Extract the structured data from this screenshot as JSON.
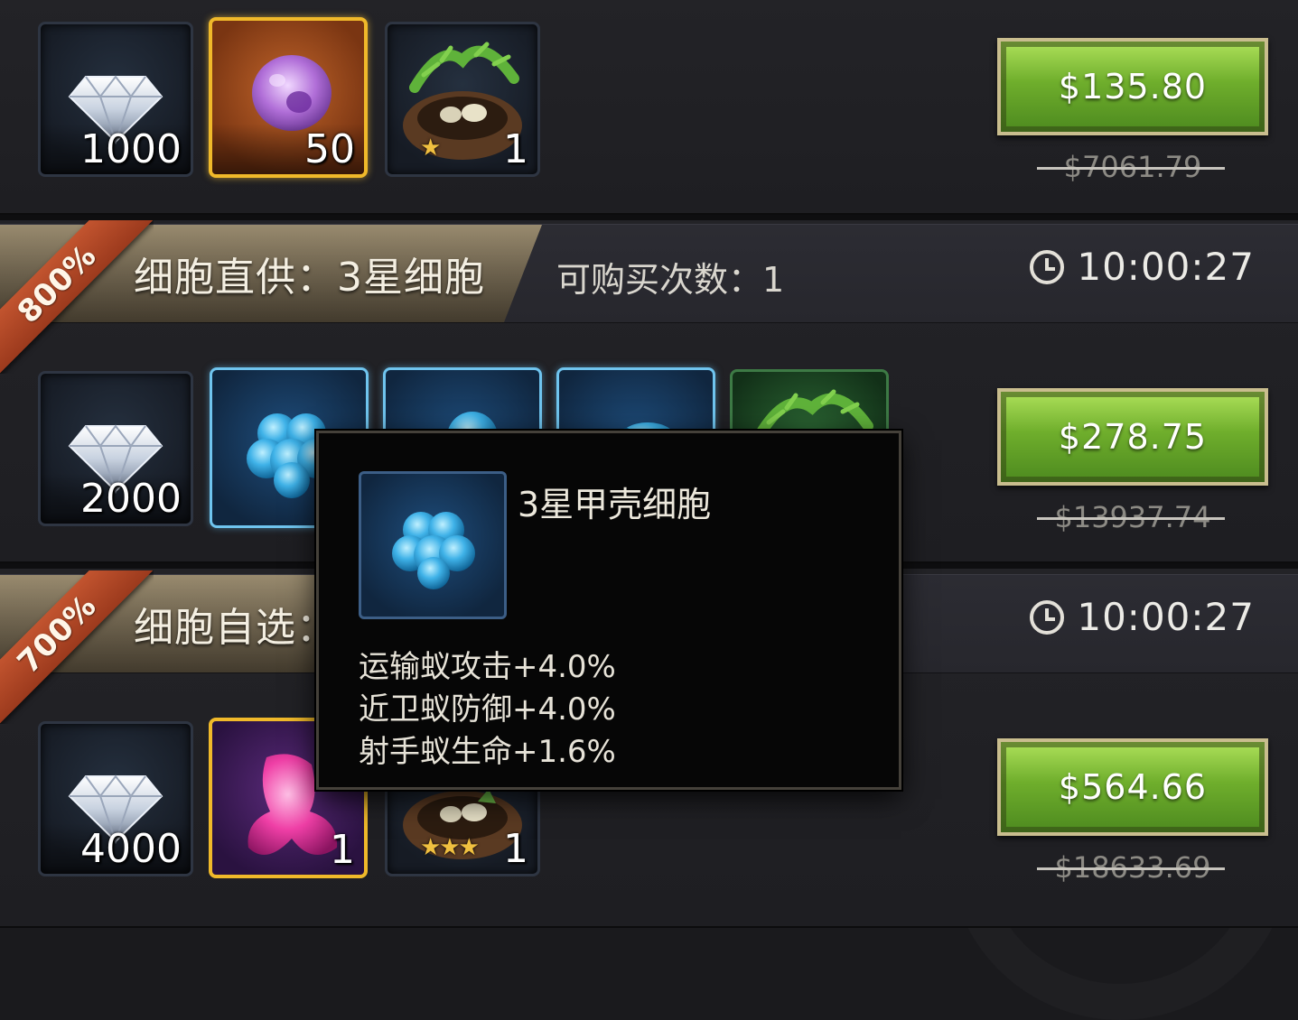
{
  "offers": [
    {
      "items": [
        {
          "icon": "diamond-icon",
          "count": "1000"
        },
        {
          "icon": "purple-cell-icon",
          "count": "50"
        },
        {
          "icon": "nest-icon",
          "count": "1",
          "stars": "★"
        }
      ],
      "price": "$135.80",
      "original_price": "$7061.79"
    },
    {
      "badge": "800%",
      "title": "细胞直供：3星细胞",
      "limit": "可购买次数：1",
      "timer": "10:00:27",
      "items": [
        {
          "icon": "diamond-icon",
          "count": "2000"
        },
        {
          "icon": "blue-cell-icon"
        },
        {
          "icon": "blue-cell-icon"
        },
        {
          "icon": "blue-cell-icon"
        },
        {
          "icon": "nest-icon"
        }
      ],
      "price": "$278.75",
      "original_price": "$13937.74"
    },
    {
      "badge": "700%",
      "title": "细胞自选：",
      "timer": "10:00:27",
      "items": [
        {
          "icon": "diamond-icon",
          "count": "4000"
        },
        {
          "icon": "pink-cell-icon",
          "count": "1"
        },
        {
          "icon": "nest-icon",
          "count": "1",
          "stars": "★★★"
        }
      ],
      "price": "$564.66",
      "original_price": "$18633.69"
    }
  ],
  "tooltip": {
    "title": "3星甲壳细胞",
    "icon": "blue-cell-icon",
    "stats": [
      "运输蚁攻击+4.0%",
      "近卫蚁防御+4.0%",
      "射手蚁生命+1.6%"
    ]
  },
  "colors": {
    "buy_button": "#6fae2c",
    "ribbon": "#b2472a",
    "slot_gold_border": "#f0b92a",
    "slot_blue_border": "#6fc4ee"
  }
}
